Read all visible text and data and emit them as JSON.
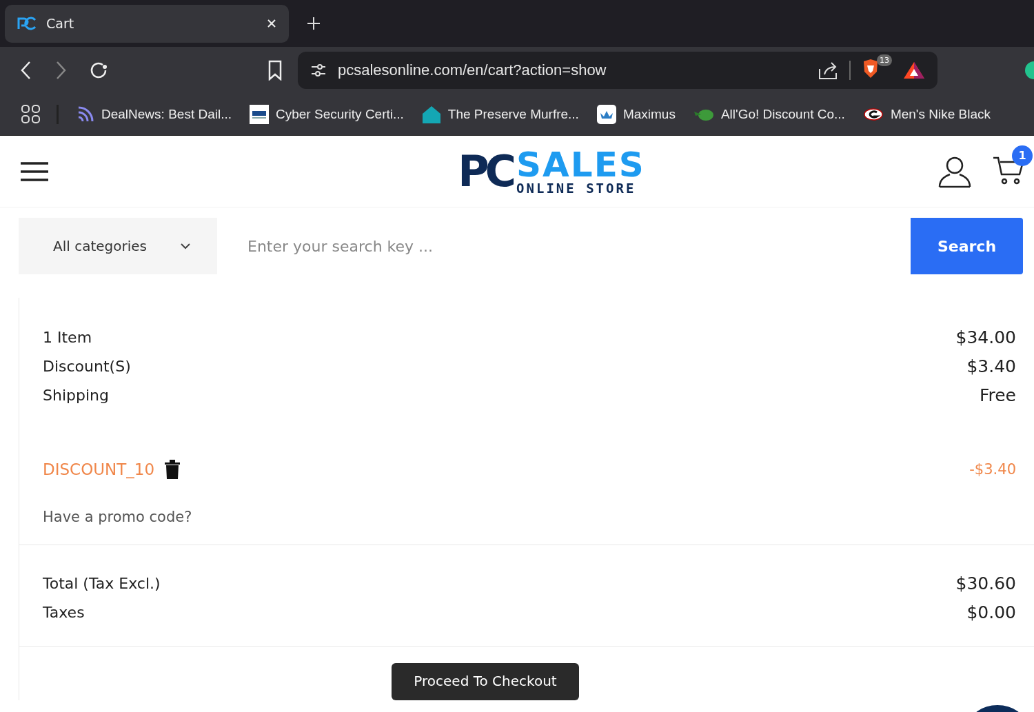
{
  "browser": {
    "tab": {
      "title": "Cart",
      "selected": true
    },
    "url": "pcsalesonline.com/en/cart?action=show",
    "shields_count": "13",
    "bookmarks": [
      {
        "label": "DealNews: Best Dail...",
        "kind": "rss"
      },
      {
        "label": "Cyber Security Certi...",
        "kind": "giac"
      },
      {
        "label": "The Preserve Murfre...",
        "kind": "house"
      },
      {
        "label": "Maximus",
        "kind": "crown"
      },
      {
        "label": "All'Go! Discount Co...",
        "kind": "go"
      },
      {
        "label": "Men's Nike Black",
        "kind": "g"
      }
    ]
  },
  "header": {
    "logo": {
      "mark": "PC",
      "name": "SALES",
      "tagline": "ONLINE STORE"
    },
    "cart_count": "1"
  },
  "search": {
    "category": "All categories",
    "placeholder": "Enter your search key ...",
    "button": "Search"
  },
  "summary": {
    "lines": [
      {
        "label": "1 Item",
        "value": "$34.00"
      },
      {
        "label": "Discount(S)",
        "value": "$3.40"
      },
      {
        "label": "Shipping",
        "value": "Free"
      }
    ],
    "voucher": {
      "code": "DISCOUNT_10",
      "amount": "-$3.40"
    },
    "promo_link": "Have a promo code?",
    "totals": [
      {
        "label": "Total (Tax Excl.)",
        "value": "$30.60"
      },
      {
        "label": "Taxes",
        "value": "$0.00"
      }
    ],
    "checkout_button": "Proceed To Checkout"
  }
}
